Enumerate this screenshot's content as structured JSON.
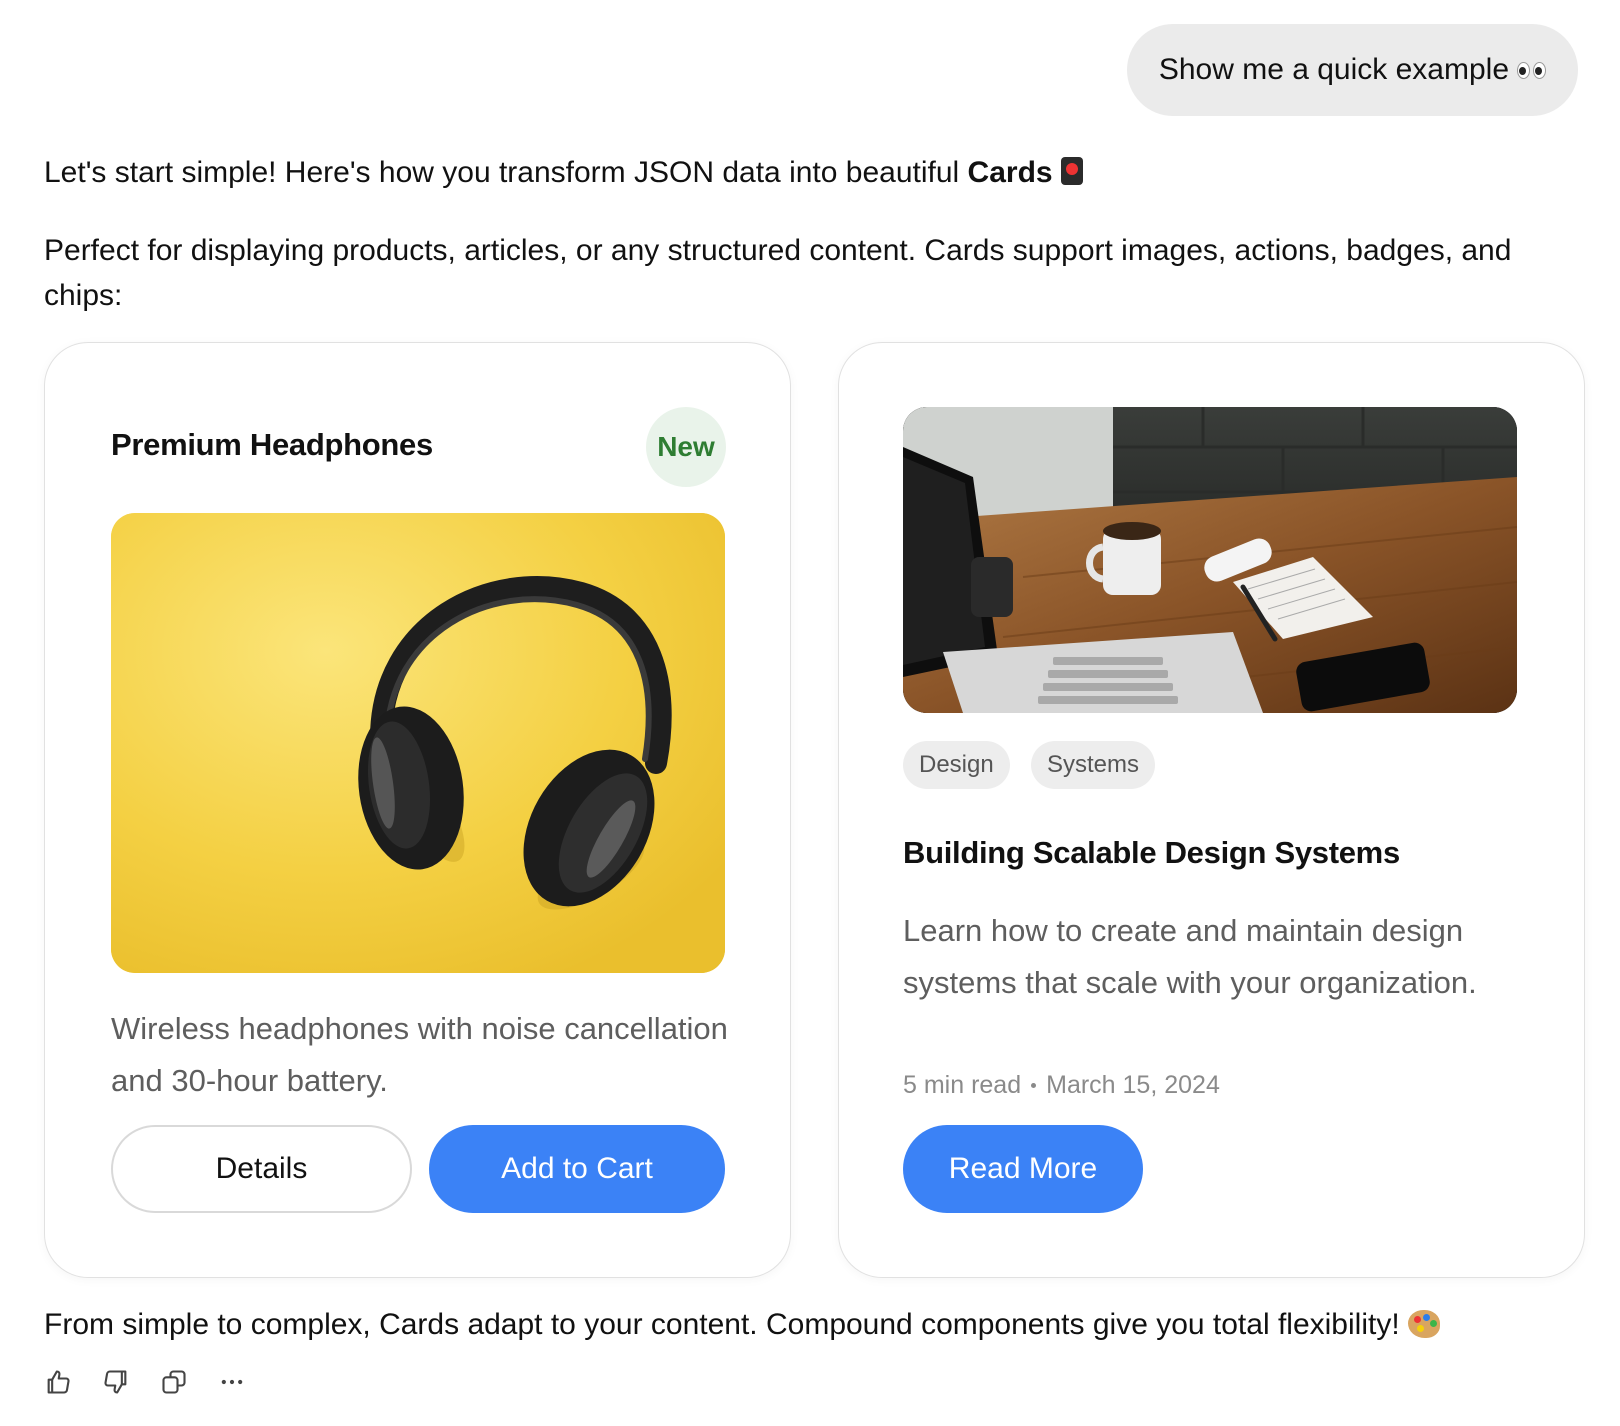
{
  "user_message": {
    "text": "Show me a quick example",
    "emoji": "eyes-emoji"
  },
  "assistant": {
    "intro_text": "Let's start simple! Here's how you transform JSON data into beautiful",
    "intro_bold": "Cards",
    "intro_emoji": "card-emoji",
    "description": "Perfect for displaying products, articles, or any structured content. Cards support images, actions, badges, and chips:",
    "outro_text": "From simple to complex, Cards adapt to your content. Compound components give you total flexibility!",
    "outro_emoji": "palette-emoji"
  },
  "product_card": {
    "title": "Premium Headphones",
    "badge": "New",
    "image_icon": "headphones-image",
    "description": "Wireless headphones with noise cancellation and 30-hour battery.",
    "details_label": "Details",
    "cart_label": "Add to Cart"
  },
  "article_card": {
    "image_icon": "desk-laptop-coffee-image",
    "chips": [
      "Design",
      "Systems"
    ],
    "title": "Building Scalable Design Systems",
    "description": "Learn how to create and maintain design systems that scale with your organization.",
    "read_time": "5 min read",
    "date": "March 15, 2024",
    "read_more_label": "Read More"
  },
  "message_actions": [
    {
      "icon": "thumbs-up-icon"
    },
    {
      "icon": "thumbs-down-icon"
    },
    {
      "icon": "copy-icon"
    },
    {
      "icon": "more-icon"
    }
  ],
  "colors": {
    "accent": "#3b82f6",
    "badge_bg": "#e9f3ea",
    "badge_text": "#2e7d32",
    "bubble_bg": "#ebebeb",
    "product_image_bg": "#f5d547"
  }
}
